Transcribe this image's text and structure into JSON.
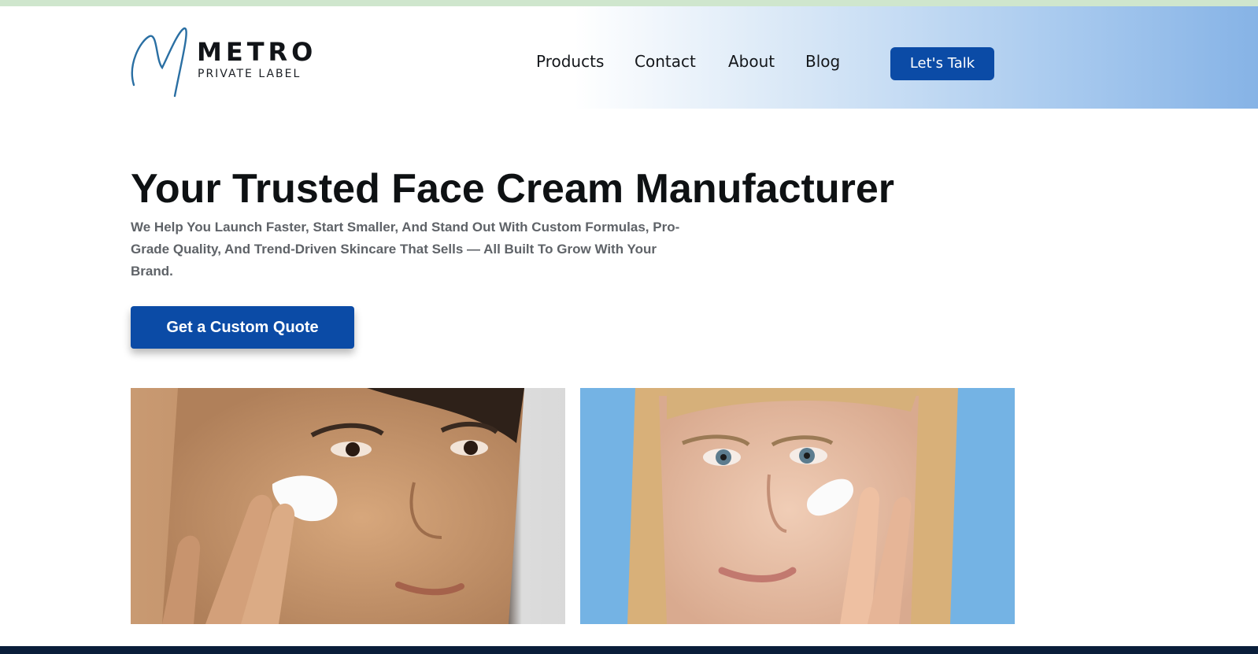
{
  "logo": {
    "word": "METRO",
    "sub": "PRIVATE LABEL",
    "icon": "m-signature-icon"
  },
  "nav": {
    "items": [
      {
        "label": "Products"
      },
      {
        "label": "Contact"
      },
      {
        "label": "About"
      },
      {
        "label": "Blog"
      }
    ],
    "cta_label": "Let's Talk"
  },
  "hero": {
    "title": "Your Trusted Face Cream Manufacturer",
    "subtitle": "We Help You Launch Faster, Start Smaller, And Stand Out With Custom Formulas, Pro-Grade Quality, And Trend-Driven Skincare That Sells — All Built To Grow With Your Brand.",
    "cta_label": "Get a Custom Quote"
  },
  "images": [
    {
      "name": "woman-applying-face-cream-photo-1",
      "background": "light-grey"
    },
    {
      "name": "woman-applying-face-cream-photo-2",
      "background": "sky-blue"
    }
  ],
  "colors": {
    "brand_blue": "#0b4ba6",
    "footer_navy": "#0a1e3a",
    "header_gradient_end": "#86b3e6",
    "top_strip": "#cfe6cd",
    "photo_1_bg": "#dcdcdc",
    "photo_2_bg": "#74b3e4"
  }
}
